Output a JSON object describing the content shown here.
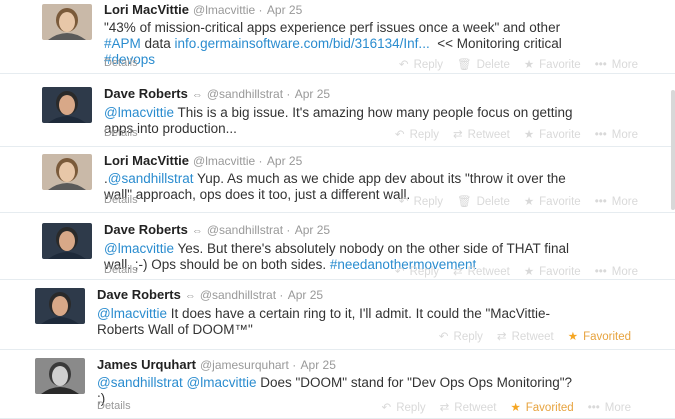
{
  "tweets": [
    {
      "fullname": "Lori MacVittie",
      "username": "@lmacvittie",
      "time": "Apr 25",
      "verified_icon": "",
      "text_parts": [
        {
          "t": "\"43% of mission-critical apps experience perf issues once a week\" and other\n",
          "link": false
        },
        {
          "t": "#APM",
          "link": true
        },
        {
          "t": " data ",
          "link": false
        },
        {
          "t": "info.germainsoftware.com/bid/316134/Inf...",
          "link": true
        },
        {
          "t": "  << Monitoring critical\n",
          "link": false
        },
        {
          "t": "#devops",
          "link": true
        }
      ],
      "details": "Details",
      "actions": [
        {
          "icon": "reply-icon",
          "glyph": "↶",
          "label": "Reply"
        },
        {
          "icon": "trash-icon",
          "glyph": "🗑",
          "label": "Delete"
        },
        {
          "icon": "star-icon",
          "glyph": "★",
          "label": "Favorite"
        },
        {
          "icon": "more-icon",
          "glyph": "•••",
          "label": "More"
        }
      ]
    },
    {
      "fullname": "Dave Roberts",
      "username": "@sandhillstrat",
      "time": "Apr 25",
      "verified_icon": "⇔",
      "text_parts": [
        {
          "t": "@lmacvittie",
          "link": true
        },
        {
          "t": " This is a big issue. It's amazing how many people focus on getting\napps into production...",
          "link": false
        }
      ],
      "details": "Details",
      "actions": [
        {
          "icon": "reply-icon",
          "glyph": "↶",
          "label": "Reply"
        },
        {
          "icon": "retweet-icon",
          "glyph": "⇄",
          "label": "Retweet"
        },
        {
          "icon": "star-icon",
          "glyph": "★",
          "label": "Favorite"
        },
        {
          "icon": "more-icon",
          "glyph": "•••",
          "label": "More"
        }
      ]
    },
    {
      "fullname": "Lori MacVittie",
      "username": "@lmacvittie",
      "time": "Apr 25",
      "verified_icon": "",
      "text_parts": [
        {
          "t": ".",
          "link": false
        },
        {
          "t": "@sandhillstrat",
          "link": true
        },
        {
          "t": " Yup. As much as we chide app dev about its \"throw it over the\nwall\" approach, ops does it too, just a different wall.",
          "link": false
        }
      ],
      "details": "Details",
      "actions": [
        {
          "icon": "reply-icon",
          "glyph": "↶",
          "label": "Reply"
        },
        {
          "icon": "trash-icon",
          "glyph": "🗑",
          "label": "Delete"
        },
        {
          "icon": "star-icon",
          "glyph": "★",
          "label": "Favorite"
        },
        {
          "icon": "more-icon",
          "glyph": "•••",
          "label": "More"
        }
      ]
    },
    {
      "fullname": "Dave Roberts",
      "username": "@sandhillstrat",
      "time": "Apr 25",
      "verified_icon": "⇔",
      "text_parts": [
        {
          "t": "@lmacvittie",
          "link": true
        },
        {
          "t": " Yes. But there's absolutely nobody on the other side of THAT final\nwall. ;-) Ops should be on both sides. ",
          "link": false
        },
        {
          "t": "#needanothermovement",
          "link": true
        }
      ],
      "details": "Details",
      "actions": [
        {
          "icon": "reply-icon",
          "glyph": "↶",
          "label": "Reply"
        },
        {
          "icon": "retweet-icon",
          "glyph": "⇄",
          "label": "Retweet"
        },
        {
          "icon": "star-icon",
          "glyph": "★",
          "label": "Favorite"
        },
        {
          "icon": "more-icon",
          "glyph": "•••",
          "label": "More"
        }
      ]
    },
    {
      "fullname": "Dave Roberts",
      "username": "@sandhillstrat",
      "time": "Apr 25",
      "verified_icon": "⇔",
      "text_parts": [
        {
          "t": "@lmacvittie",
          "link": true
        },
        {
          "t": " It does have a certain ring to it, I'll admit. It could the \"MacVittie-\nRoberts Wall of DOOM™\"",
          "link": false
        }
      ],
      "details": "",
      "actions": [
        {
          "icon": "reply-icon",
          "glyph": "↶",
          "label": "Reply"
        },
        {
          "icon": "retweet-icon",
          "glyph": "⇄",
          "label": "Retweet"
        },
        {
          "icon": "star-icon",
          "glyph": "★",
          "label": "Favorited",
          "active": true
        }
      ]
    },
    {
      "fullname": "James Urquhart",
      "username": "@jamesurquhart",
      "time": "Apr 25",
      "verified_icon": "",
      "text_parts": [
        {
          "t": "@sandhillstrat",
          "link": true
        },
        {
          "t": " ",
          "link": false
        },
        {
          "t": "@lmacvittie",
          "link": true
        },
        {
          "t": " Does \"DOOM\" stand for \"Dev Ops Ops Monitoring\"?\n;)",
          "link": false
        }
      ],
      "details": "Details",
      "actions": [
        {
          "icon": "reply-icon",
          "glyph": "↶",
          "label": "Reply"
        },
        {
          "icon": "retweet-icon",
          "glyph": "⇄",
          "label": "Retweet"
        },
        {
          "icon": "star-icon",
          "glyph": "★",
          "label": "Favorited",
          "active": true
        },
        {
          "icon": "more-icon",
          "glyph": "•••",
          "label": "More"
        }
      ]
    }
  ],
  "colors": {
    "link": "#2a8ccf",
    "muted": "#999999",
    "favorited": "#e7a33e"
  }
}
